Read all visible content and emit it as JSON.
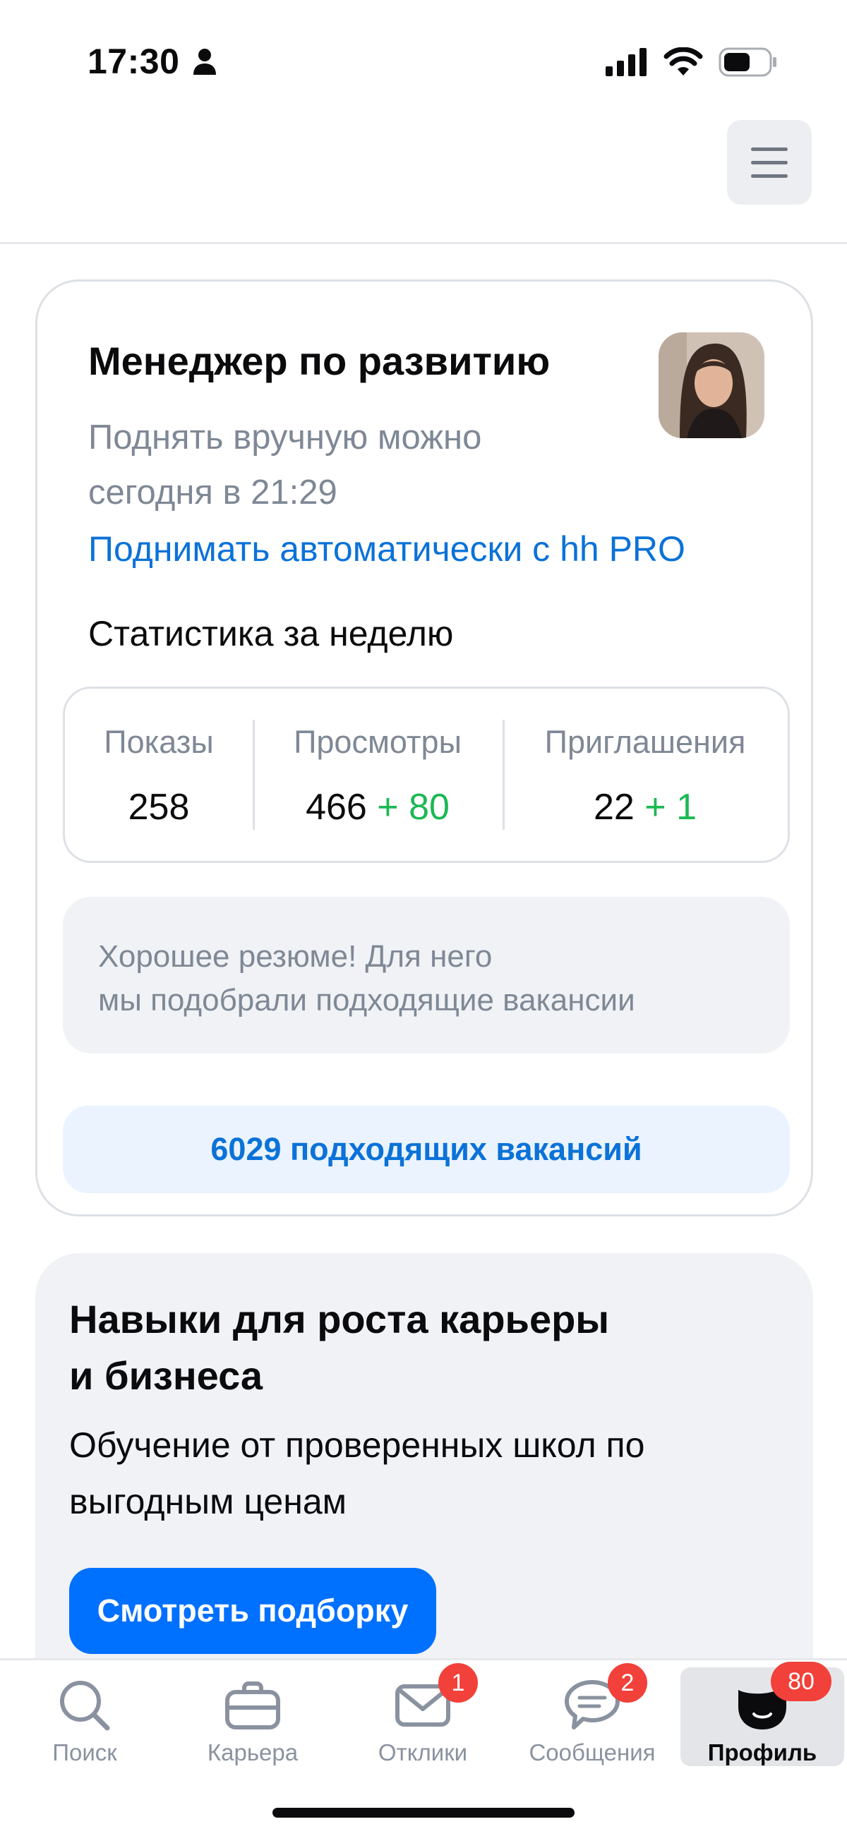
{
  "status_bar": {
    "time": "17:30",
    "icons": [
      "person-icon",
      "signal-icon",
      "wifi-icon",
      "battery-icon"
    ]
  },
  "header": {
    "menu_icon": "hamburger-icon"
  },
  "resume": {
    "title": "Менеджер по развитию",
    "raise_text": "Поднять вручную можно сегодня в 21:29",
    "hh_pro_link": "Поднимать автоматически с hh PRO",
    "stats_title": "Статистика за неделю",
    "stats": [
      {
        "label": "Показы",
        "value": "258",
        "delta": ""
      },
      {
        "label": "Просмотры",
        "value": "466",
        "delta": "+ 80"
      },
      {
        "label": "Приглашения",
        "value": "22",
        "delta": "+ 1"
      }
    ],
    "good_resume_text": "Хорошее резюме! Для него\nмы подобрали подходящие вакансии",
    "vacancies_button": "6029 подходящих вакансий"
  },
  "skills": {
    "title": "Навыки для роста карьеры\nи бизнеса",
    "subtitle": "Обучение от проверенных школ по выгодным ценам",
    "button": "Смотреть подборку"
  },
  "tab_bar": {
    "tabs": [
      {
        "label": "Поиск",
        "icon": "search-icon",
        "badge": ""
      },
      {
        "label": "Карьера",
        "icon": "briefcase-icon",
        "badge": ""
      },
      {
        "label": "Отклики",
        "icon": "envelope-icon",
        "badge": "1"
      },
      {
        "label": "Сообщения",
        "icon": "chat-icon",
        "badge": "2"
      },
      {
        "label": "Профиль",
        "icon": "profile-icon",
        "badge": "80"
      }
    ],
    "active": "Профиль"
  },
  "colors": {
    "accent": "#0070ff",
    "link": "#0b72d8",
    "positive": "#1bb954",
    "badge": "#f1413a",
    "muted_text": "#7f8895"
  }
}
